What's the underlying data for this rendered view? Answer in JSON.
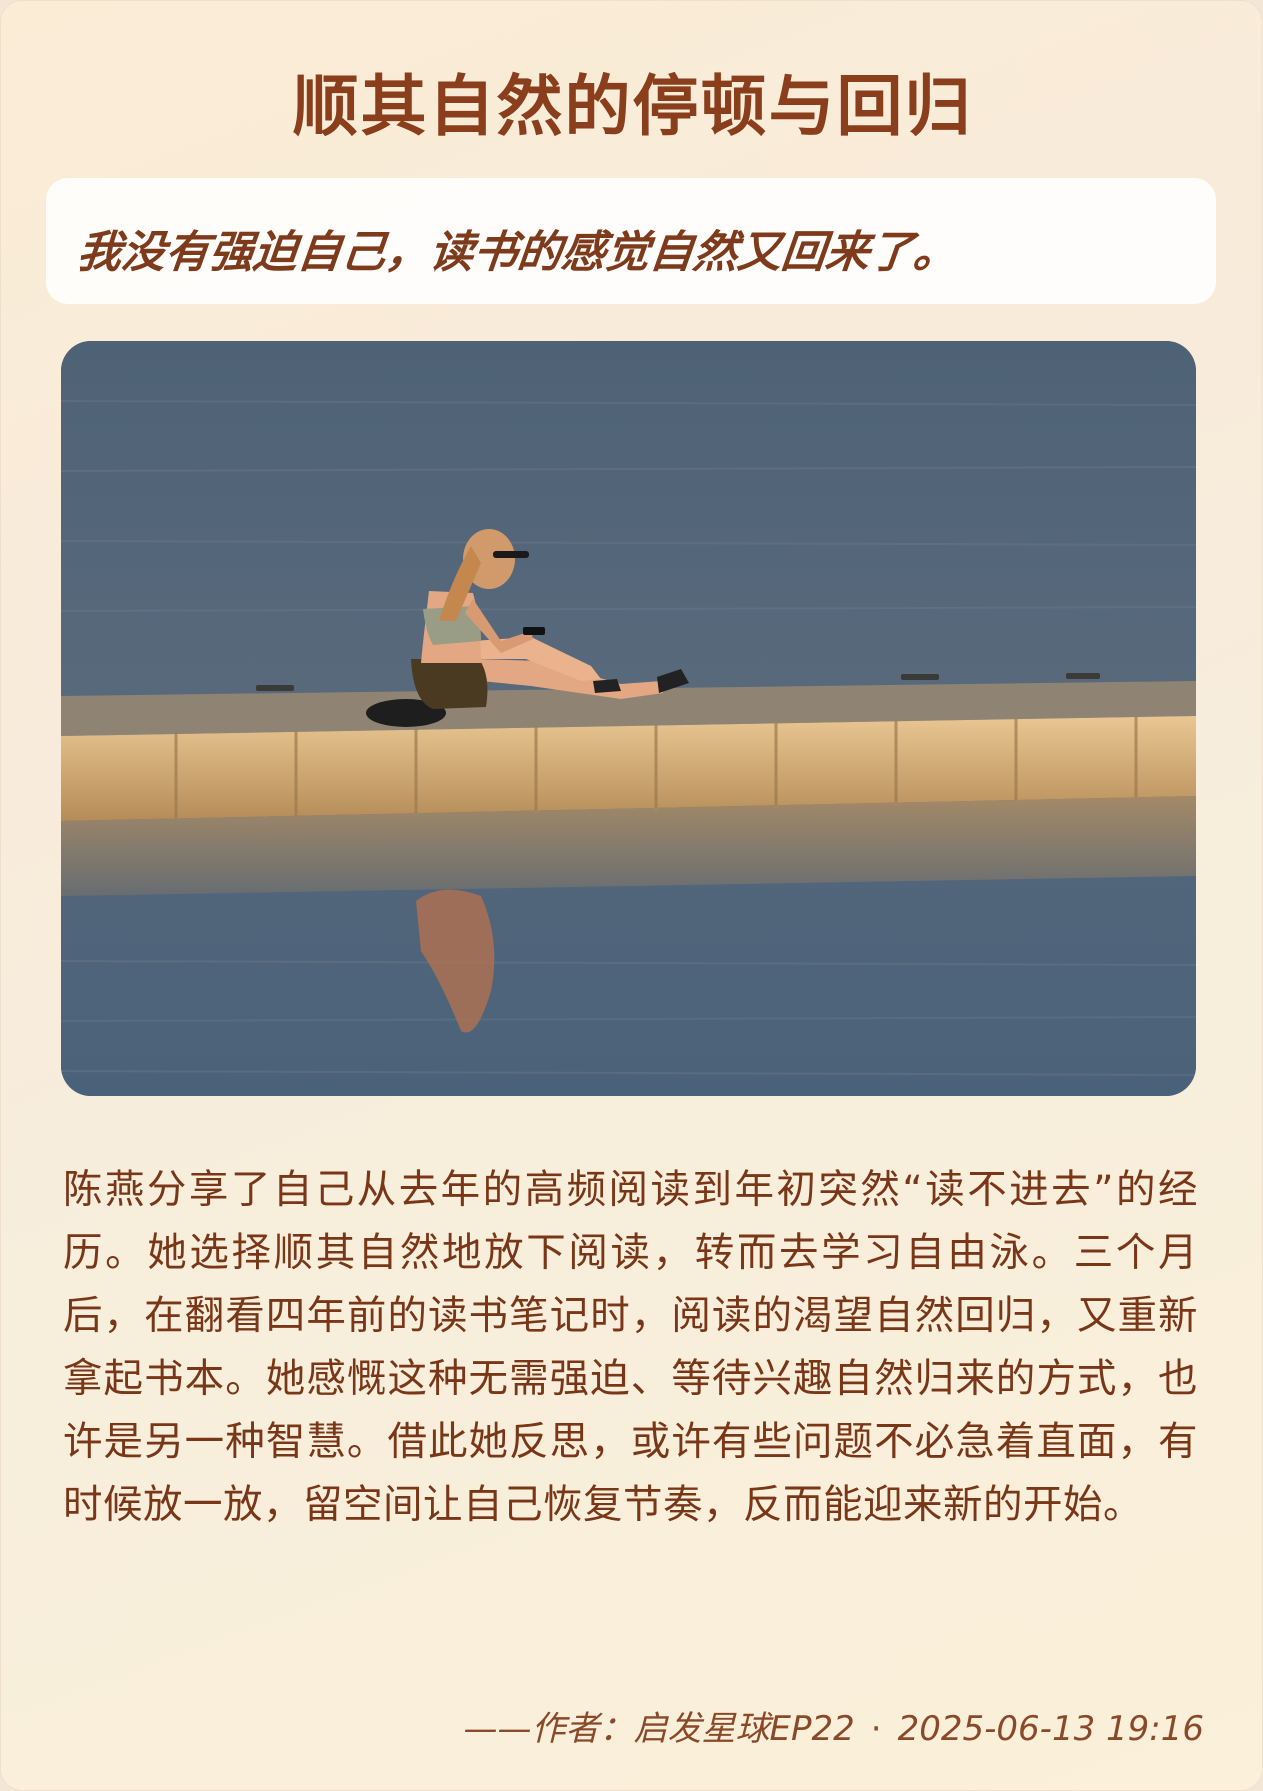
{
  "title": "顺其自然的停顿与回归",
  "quote": "我没有强迫自己，读书的感觉自然又回来了。",
  "photo": {
    "icon": "photo-woman-on-dock-icon"
  },
  "body": "陈燕分享了自己从去年的高频阅读到年初突然“读不进去”的经历。她选择顺其自然地放下阅读，转而去学习自由泳。三个月后，在翻看四年前的读书笔记时，阅读的渴望自然回归，又重新拿起书本。她感慨这种无需强迫、等待兴趣自然归来的方式，也许是另一种智慧。借此她反思，或许有些问题不必急着直面，有时候放一放，留空间让自己恢复节奏，反而能迎来新的开始。",
  "footer": {
    "prefix": "——作者：启发星球EP22",
    "separator": "·",
    "date": "2025-06-13 19:16"
  },
  "colors": {
    "title": "#8a3e1c",
    "quote": "#7e3b1c",
    "body": "#7a3718",
    "footer": "#8a4a2a"
  }
}
